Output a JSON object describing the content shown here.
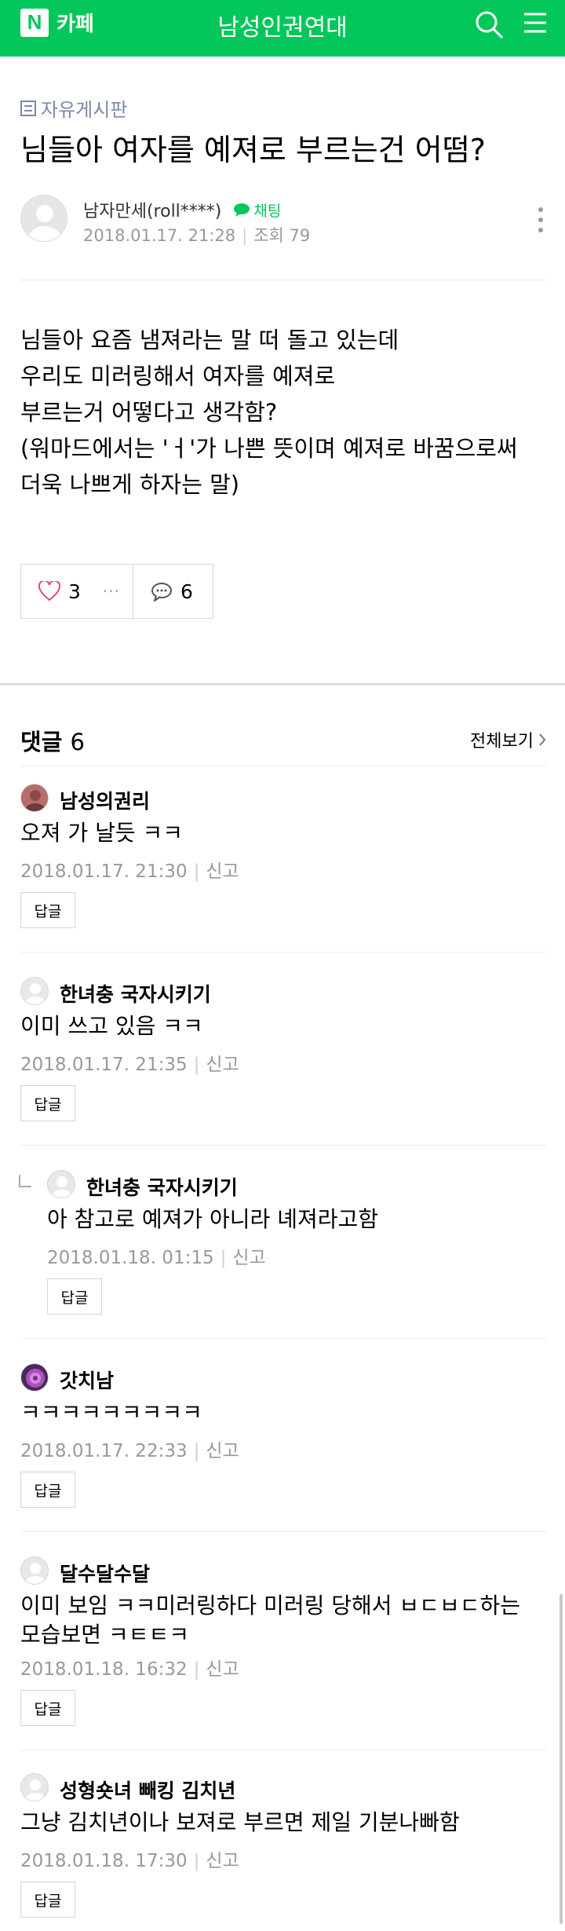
{
  "header": {
    "logo_letter": "N",
    "logo_text": "카페",
    "cafe_name": "남성인권연대",
    "brand_color": "#03c75a",
    "search_icon": "search-icon",
    "menu_icon": "hamburger-menu-icon"
  },
  "article": {
    "board_name": "자유게시판",
    "title": "님들아 여자를 예져로 부르는건 어떰?",
    "author": "남자만세(roll****)",
    "chat_label": "채팅",
    "date": "2018.01.17. 21:28",
    "views_label": "조회 79",
    "body": [
      "님들아 요즘 냄져라는 말 떠 돌고 있는데",
      "우리도 미러링해서 여자를 예져로",
      "부르는거 어떻다고 생각함?",
      "(워마드에서는 'ㅓ'가 나쁜 뜻이며 예져로 바꿈으로써",
      "더욱 나쁘게 하자는 말)"
    ],
    "like_count": "3",
    "more_dots": "···",
    "comment_count": "6"
  },
  "comments_section": {
    "title": "댓글",
    "count": "6",
    "view_all": "전체보기"
  },
  "comments": [
    {
      "name": "남성의권리",
      "text": "오져 가 날듯 ㅋㅋ",
      "date": "2018.01.17. 21:30",
      "report": "신고",
      "reply_btn": "답글"
    },
    {
      "name": "한녀충 국자시키기",
      "text": "이미 쓰고 있음 ㅋㅋ",
      "date": "2018.01.17. 21:35",
      "report": "신고",
      "reply_btn": "답글"
    },
    {
      "name": "한녀충 국자시키기",
      "text": "아 참고로 예져가 아니라 녜져라고함",
      "date": "2018.01.18. 01:15",
      "report": "신고",
      "reply_btn": "답글"
    },
    {
      "name": "갓치남",
      "text": "ㅋㅋㅋㅋㅋㅋㅋㅋㅋ",
      "date": "2018.01.17. 22:33",
      "report": "신고",
      "reply_btn": "답글"
    },
    {
      "name": "달수달수달",
      "text": "이미 보임 ㅋㅋ미러링하다 미러링 당해서 ㅂㄷㅂㄷ하는 모습보면 ㅋㅌㅌㅋ",
      "date": "2018.01.18. 16:32",
      "report": "신고",
      "reply_btn": "답글"
    },
    {
      "name": "성형숏녀 빼킹 김치년",
      "text": "그냥 김치년이나 보져로 부르면 제일 기분나빠함",
      "date": "2018.01.18. 17:30",
      "report": "신고",
      "reply_btn": "답글"
    }
  ]
}
